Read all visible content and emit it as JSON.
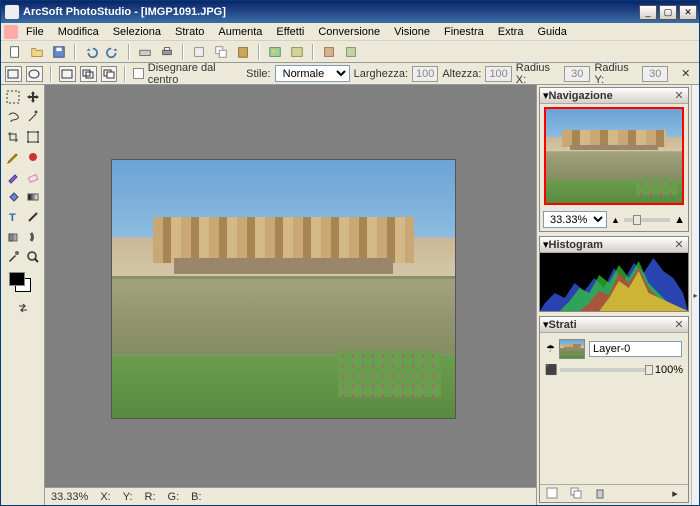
{
  "window": {
    "title": "ArcSoft PhotoStudio - [IMGP1091.JPG]",
    "min": "_",
    "max": "▢",
    "close": "✕"
  },
  "menu": {
    "items": [
      "File",
      "Modifica",
      "Seleziona",
      "Strato",
      "Aumenta",
      "Effetti",
      "Conversione",
      "Visione",
      "Finestra",
      "Extra",
      "Guida"
    ]
  },
  "options": {
    "draw_center": "Disegnare dal centro",
    "style_label": "Stile:",
    "style_value": "Normale",
    "width_label": "Larghezza:",
    "width_value": "100",
    "height_label": "Altezza:",
    "height_value": "100",
    "rx_label": "Radius X:",
    "rx_value": "30",
    "ry_label": "Radius Y:",
    "ry_value": "30"
  },
  "status": {
    "zoom": "33.33%",
    "x": "X:",
    "y": "Y:",
    "r": "R:",
    "g": "G:",
    "b": "B:"
  },
  "panels": {
    "nav_title": "Navigazione",
    "zoom_value": "33.33%",
    "histo_title": "Histogram",
    "layers_title": "Strati",
    "layer0": "Layer-0",
    "opacity": "100%"
  },
  "colors": {
    "accent": "#2a6fbf",
    "selection": "#ff0000"
  }
}
